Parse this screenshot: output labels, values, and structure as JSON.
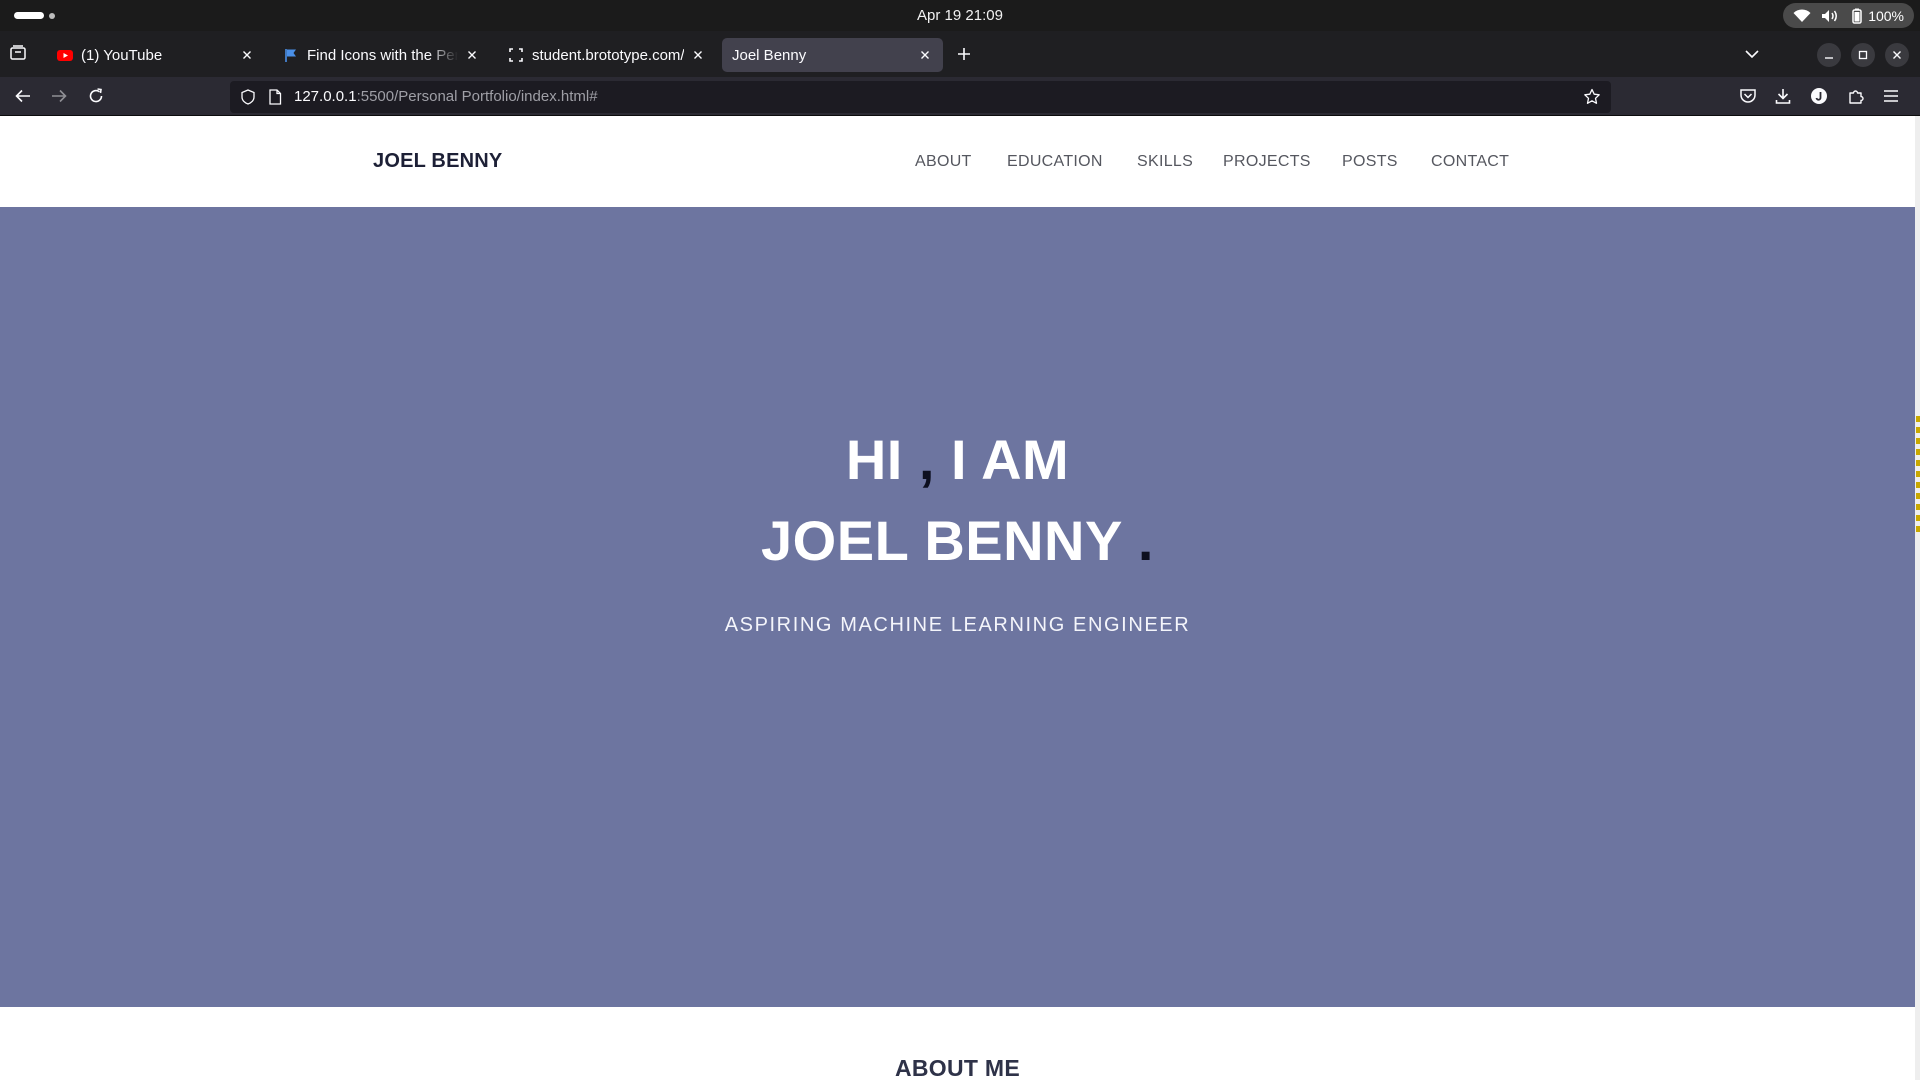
{
  "os": {
    "clock": "Apr 19  21:09",
    "battery": "100%"
  },
  "tabs": [
    {
      "title": "(1) YouTube",
      "icon": "youtube-icon",
      "active": false
    },
    {
      "title": "Find Icons with the Perfect",
      "icon": "flag-icon",
      "active": false
    },
    {
      "title": "student.brototype.com/",
      "icon": "brototype-icon",
      "active": false
    },
    {
      "title": "Joel Benny",
      "icon": "",
      "active": true
    }
  ],
  "urlbar": {
    "host": "127.0.0.1",
    "path": ":5500/Personal Portfolio/index.html#"
  },
  "site": {
    "brand": "JOEL BENNY",
    "nav": [
      "ABOUT",
      "EDUCATION",
      "SKILLS",
      "PROJECTS",
      "POSTS",
      "CONTACT"
    ],
    "hero": {
      "line1_a": "HI ",
      "line1_comma": ",",
      "line1_b": " I AM",
      "line2_name": "JOEL BENNY ",
      "line2_dot": ".",
      "subtitle": "ASPIRING MACHINE LEARNING ENGINEER"
    },
    "next_section_title": "ABOUT ME"
  },
  "colors": {
    "hero_bg": "#6d75a0",
    "accent": "#0d0f1f",
    "browser_dark": "#1f1f22"
  }
}
